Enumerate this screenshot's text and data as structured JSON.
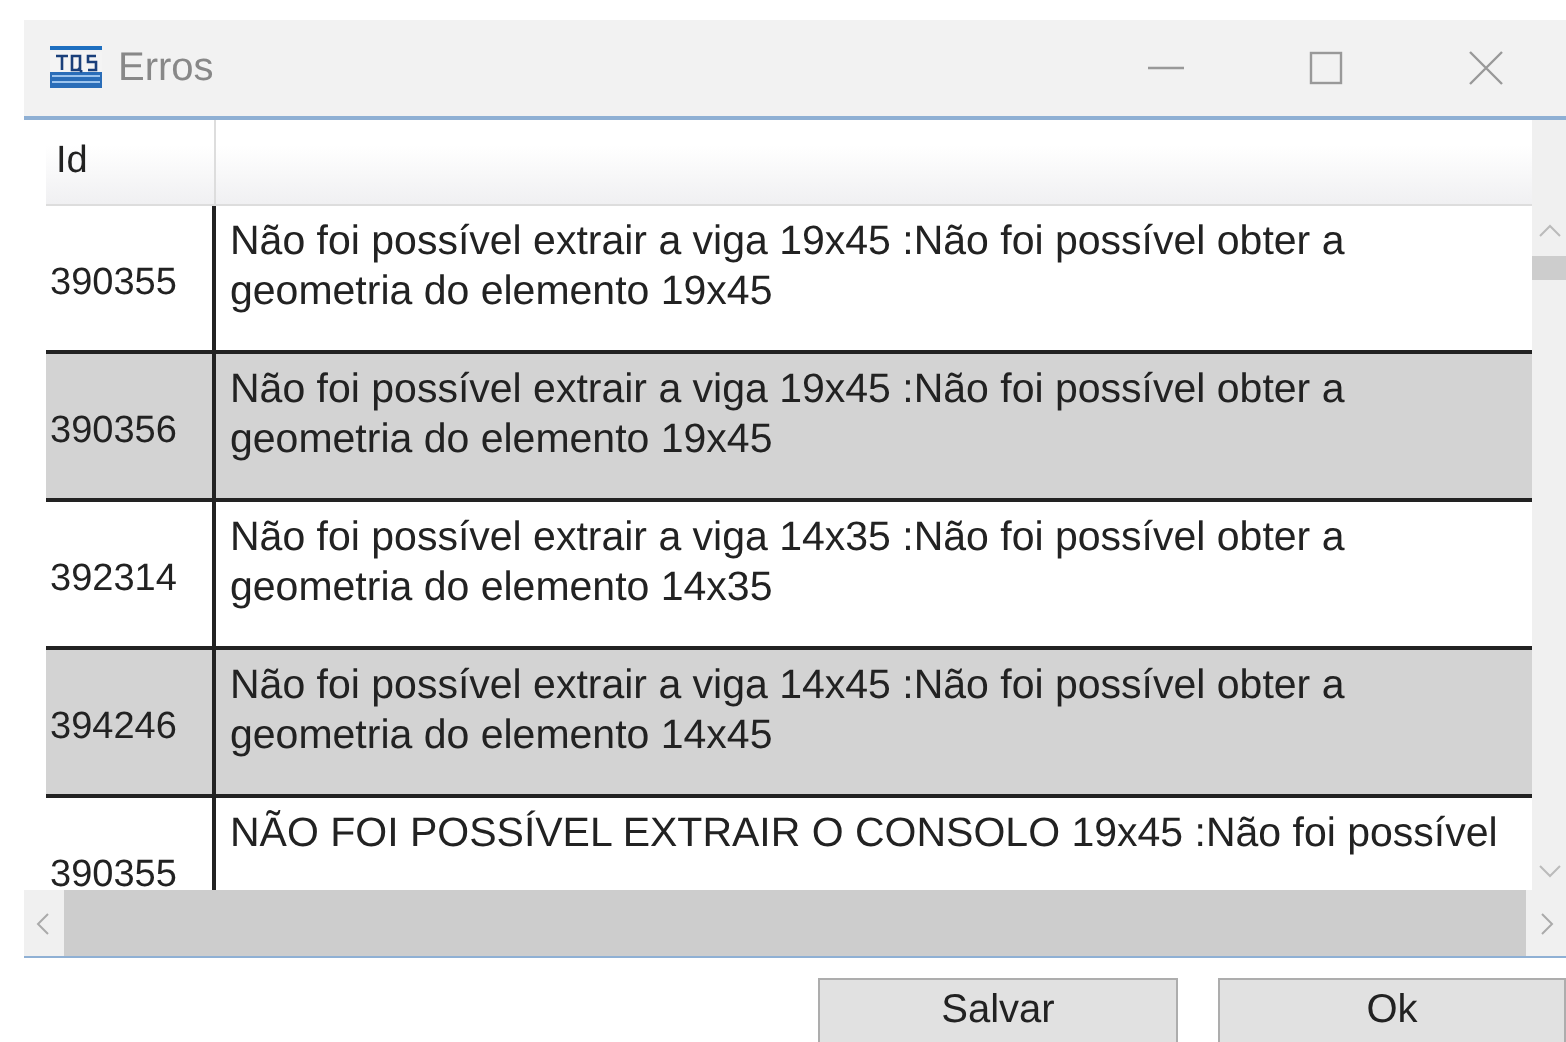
{
  "window": {
    "title": "Erros"
  },
  "table": {
    "columns": [
      "Id"
    ],
    "rows": [
      {
        "id": "390355",
        "message": "Não foi possível extrair a viga 19x45 :Não foi possível obter a geometria do elemento 19x45",
        "shaded": false
      },
      {
        "id": "390356",
        "message": "Não foi possível extrair a viga 19x45 :Não foi possível obter a geometria do elemento 19x45",
        "shaded": true
      },
      {
        "id": "392314",
        "message": "Não foi possível extrair a viga 14x35 :Não foi possível obter a geometria do elemento 14x35",
        "shaded": false
      },
      {
        "id": "394246",
        "message": "Não foi possível extrair a viga 14x45 :Não foi possível obter a geometria do elemento 14x45",
        "shaded": true
      },
      {
        "id": "390355",
        "message": "NÃO FOI POSSÍVEL EXTRAIR O CONSOLO 19x45 :Não foi possível",
        "shaded": false
      }
    ]
  },
  "buttons": [
    "Salvar",
    "Ok"
  ]
}
